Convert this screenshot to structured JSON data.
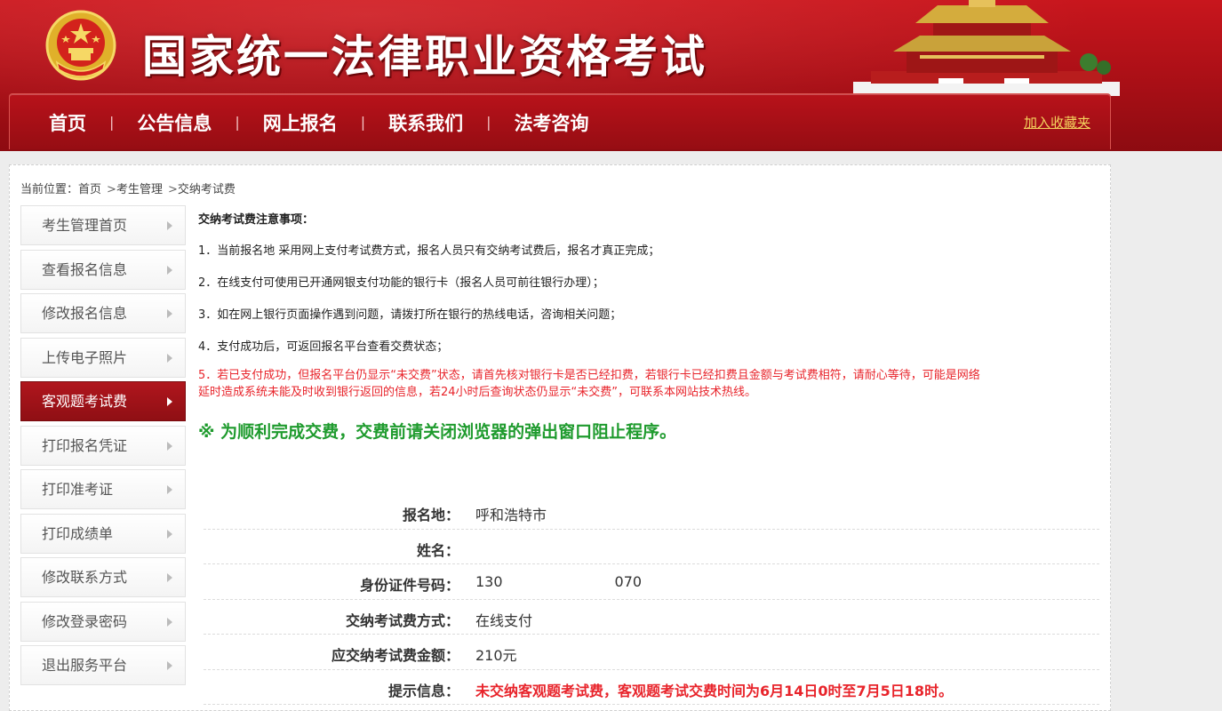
{
  "header": {
    "site_title": "国家统一法律职业资格考试",
    "colors": {
      "primary_red": "#b8121a",
      "accent_gold": "#f4d35e"
    }
  },
  "nav": {
    "items": [
      "首页",
      "公告信息",
      "网上报名",
      "联系我们",
      "法考咨询"
    ],
    "separator": "|",
    "favorite_label": "加入收藏夹"
  },
  "breadcrumb": {
    "prefix": "当前位置：",
    "items": [
      "首页",
      "考生管理",
      "交纳考试费"
    ],
    "separator": ">"
  },
  "sidebar": {
    "items": [
      {
        "label": "考生管理首页",
        "active": false
      },
      {
        "label": "查看报名信息",
        "active": false
      },
      {
        "label": "修改报名信息",
        "active": false
      },
      {
        "label": "上传电子照片",
        "active": false
      },
      {
        "label": "客观题考试费",
        "active": true
      },
      {
        "label": "打印报名凭证",
        "active": false
      },
      {
        "label": "打印准考证",
        "active": false
      },
      {
        "label": "打印成绩单",
        "active": false
      },
      {
        "label": "修改联系方式",
        "active": false
      },
      {
        "label": "修改登录密码",
        "active": false
      },
      {
        "label": "退出服务平台",
        "active": false
      }
    ]
  },
  "notice": {
    "title": "交纳考试费注意事项：",
    "lines": [
      "1．当前报名地 采用网上支付考试费方式，报名人员只有交纳考试费后，报名才真正完成；",
      "2．在线支付可使用已开通网银支付功能的银行卡（报名人员可前往银行办理）；",
      "3．如在网上银行页面操作遇到问题，请拨打所在银行的热线电话，咨询相关问题；",
      "4．支付成功后，可返回报名平台查看交费状态；"
    ],
    "warning_line1": "5．若已支付成功，但报名平台仍显示“未交费”状态，请首先核对银行卡是否已经扣费，若银行卡已经扣费且金额与考试费相符，请耐心等待，可能是网络",
    "warning_line2": "延时造成系统未能及时收到银行返回的信息，若24小时后查询状态仍显示“未交费”，可联系本网站技术热线。",
    "tip": "※ 为顺利完成交费，交费前请关闭浏览器的弹出窗口阻止程序。"
  },
  "info": {
    "rows": [
      {
        "label": "报名地：",
        "value": "呼和浩特市"
      },
      {
        "label": "姓名：",
        "value": ""
      },
      {
        "label": "身份证件号码：",
        "value": "130",
        "value_tail": "070"
      },
      {
        "label": "交纳考试费方式：",
        "value": "在线支付"
      },
      {
        "label": "应交纳考试费金额：",
        "value": "210元"
      },
      {
        "label": "提示信息：",
        "value": "未交纳客观题考试费，客观题考试交费时间为6月14日0时至7月5日18时。"
      }
    ]
  }
}
